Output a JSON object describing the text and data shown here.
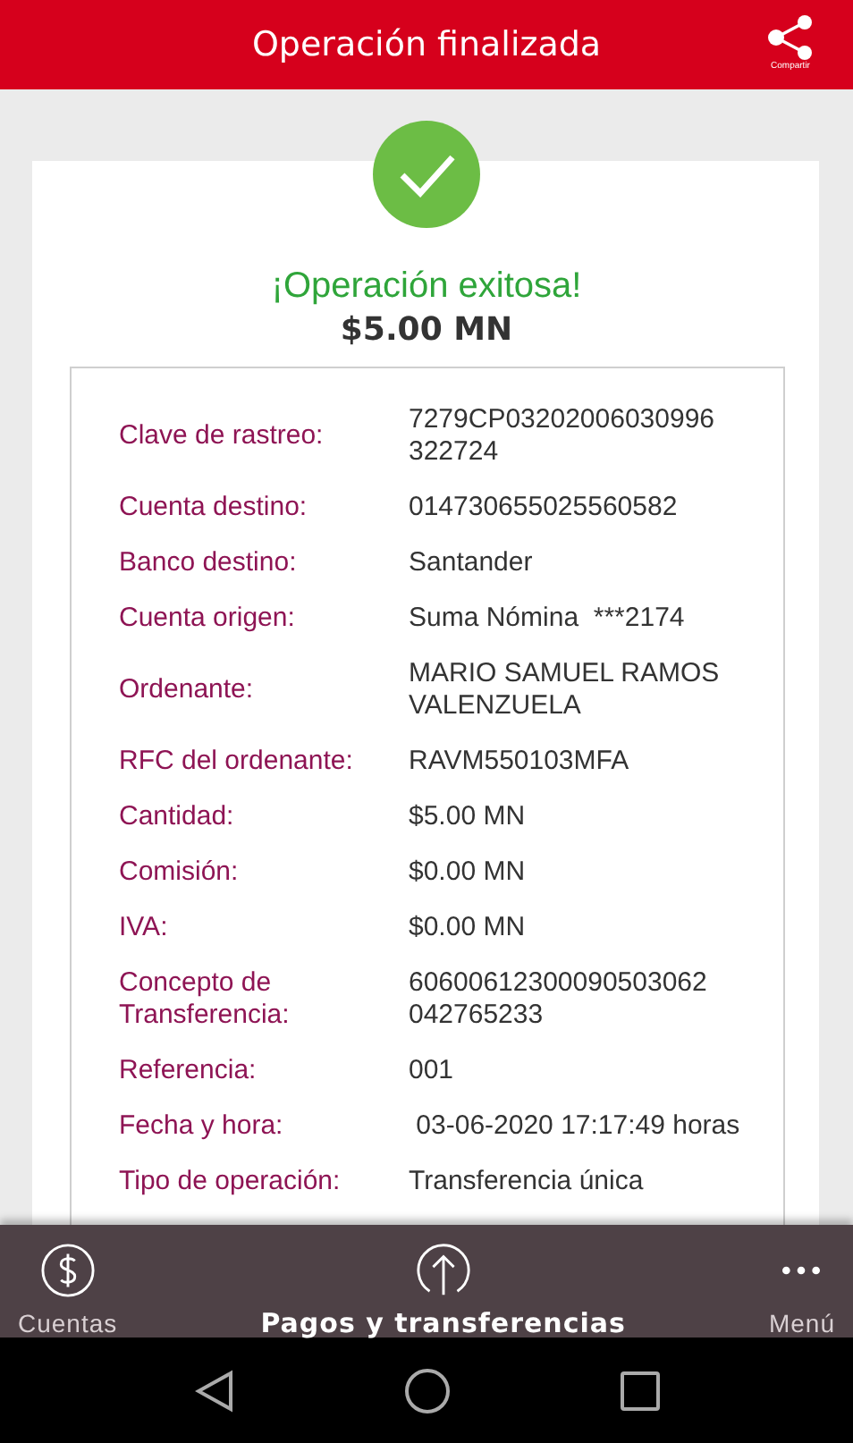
{
  "header": {
    "title": "Operación finalizada",
    "share_label": "Compartir"
  },
  "result": {
    "message": "¡Operación exitosa!",
    "amount": "$5.00 MN"
  },
  "details": [
    {
      "label": "Clave de rastreo:",
      "value": "7279CP03202006030996 322724"
    },
    {
      "label": "Cuenta destino:",
      "value": "014730655025560582"
    },
    {
      "label": "Banco destino:",
      "value": "Santander"
    },
    {
      "label": "Cuenta origen:",
      "value": "Suma Nómina  ***2174"
    },
    {
      "label": "Ordenante:",
      "value": "MARIO SAMUEL RAMOS VALENZUELA"
    },
    {
      "label": "RFC del ordenante:",
      "value": "RAVM550103MFA"
    },
    {
      "label": "Cantidad:",
      "value": "$5.00 MN"
    },
    {
      "label": "Comisión:",
      "value": "$0.00 MN"
    },
    {
      "label": "IVA:",
      "value": "$0.00 MN"
    },
    {
      "label": "Concepto de Transferencia:",
      "value": "60600612300090503062 042765233"
    },
    {
      "label": "Referencia:",
      "value": "001"
    },
    {
      "label": "Fecha y hora:",
      "value": " 03-06-2020 17:17:49 horas"
    },
    {
      "label": "Tipo de operación:",
      "value": "Transferencia única"
    }
  ],
  "bottom_nav": [
    {
      "label": "Cuentas",
      "selected": false
    },
    {
      "label": "Pagos y transferencias",
      "selected": true
    },
    {
      "label": "Menú",
      "selected": false
    }
  ]
}
